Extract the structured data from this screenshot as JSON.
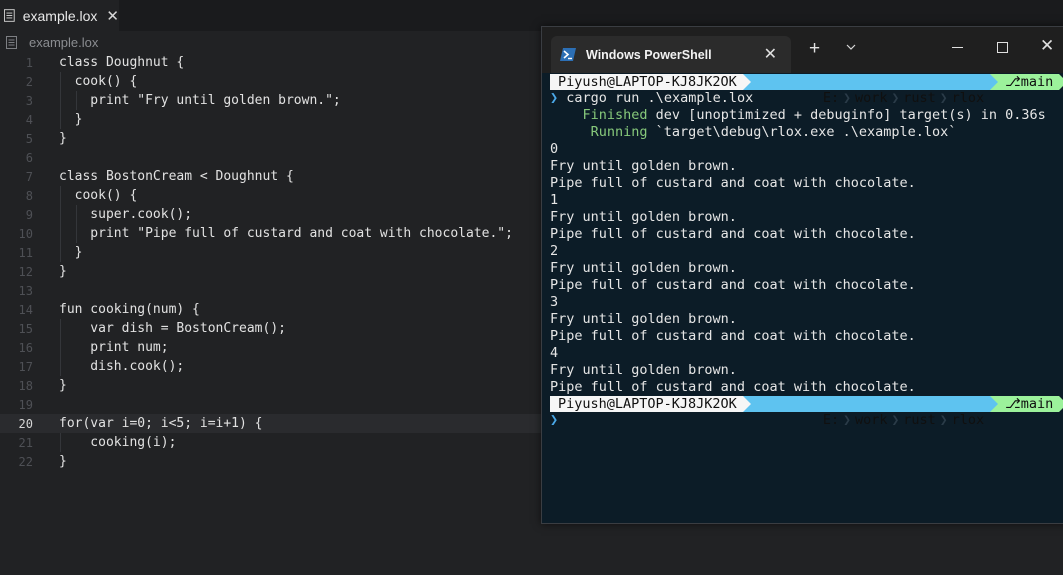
{
  "editor": {
    "tab_label": "example.lox",
    "tab_close": "✕",
    "breadcrumb": "example.lox",
    "active_line": 20,
    "lines": [
      {
        "n": "1",
        "t": "class Doughnut {",
        "indent": 0
      },
      {
        "n": "2",
        "t": "  cook() {",
        "indent": 1
      },
      {
        "n": "3",
        "t": "    print \"Fry until golden brown.\";",
        "indent": 2
      },
      {
        "n": "4",
        "t": "  }",
        "indent": 1
      },
      {
        "n": "5",
        "t": "}",
        "indent": 0
      },
      {
        "n": "6",
        "t": "",
        "indent": 0
      },
      {
        "n": "7",
        "t": "class BostonCream < Doughnut {",
        "indent": 0
      },
      {
        "n": "8",
        "t": "  cook() {",
        "indent": 1
      },
      {
        "n": "9",
        "t": "    super.cook();",
        "indent": 2
      },
      {
        "n": "10",
        "t": "    print \"Pipe full of custard and coat with chocolate.\";",
        "indent": 2
      },
      {
        "n": "11",
        "t": "  }",
        "indent": 1
      },
      {
        "n": "12",
        "t": "}",
        "indent": 0
      },
      {
        "n": "13",
        "t": "",
        "indent": 0
      },
      {
        "n": "14",
        "t": "fun cooking(num) {",
        "indent": 0
      },
      {
        "n": "15",
        "t": "    var dish = BostonCream();",
        "indent": 1
      },
      {
        "n": "16",
        "t": "    print num;",
        "indent": 1
      },
      {
        "n": "17",
        "t": "    dish.cook();",
        "indent": 1
      },
      {
        "n": "18",
        "t": "}",
        "indent": 0
      },
      {
        "n": "19",
        "t": "",
        "indent": 0
      },
      {
        "n": "20",
        "t": "for(var i=0; i<5; i=i+1) {",
        "indent": 0
      },
      {
        "n": "21",
        "t": "    cooking(i);",
        "indent": 1
      },
      {
        "n": "22",
        "t": "}",
        "indent": 0
      }
    ]
  },
  "terminal": {
    "tab_title": "Windows PowerShell",
    "tab_close": "✕",
    "new_tab": "+",
    "win_close": "✕",
    "prompt": {
      "user": "Piyush@LAPTOP-KJ8JK2OK",
      "drive": "E:",
      "path": [
        "work",
        "rust",
        "rlox"
      ],
      "branch": "main"
    },
    "command_symbol": "❯",
    "command": "cargo run .\\example.lox",
    "finished_label": "Finished",
    "finished_rest": " dev [unoptimized + debuginfo] target(s) in 0.36s",
    "running_label": "Running",
    "running_rest": " `target\\debug\\rlox.exe .\\example.lox`",
    "output": [
      "0",
      "Fry until golden brown.",
      "Pipe full of custard and coat with chocolate.",
      "1",
      "Fry until golden brown.",
      "Pipe full of custard and coat with chocolate.",
      "2",
      "Fry until golden brown.",
      "Pipe full of custard and coat with chocolate.",
      "3",
      "Fry until golden brown.",
      "Pipe full of custard and coat with chocolate.",
      "4",
      "Fry until golden brown.",
      "Pipe full of custard and coat with chocolate."
    ]
  },
  "colors": {
    "editor_bg": "#212224",
    "terminal_bg": "#0c1c27",
    "prompt_path": "#5ec3f0",
    "prompt_git": "#9cf29b",
    "cargo_green": "#87c97b",
    "prompt_symbol": "#4aa8e8"
  }
}
